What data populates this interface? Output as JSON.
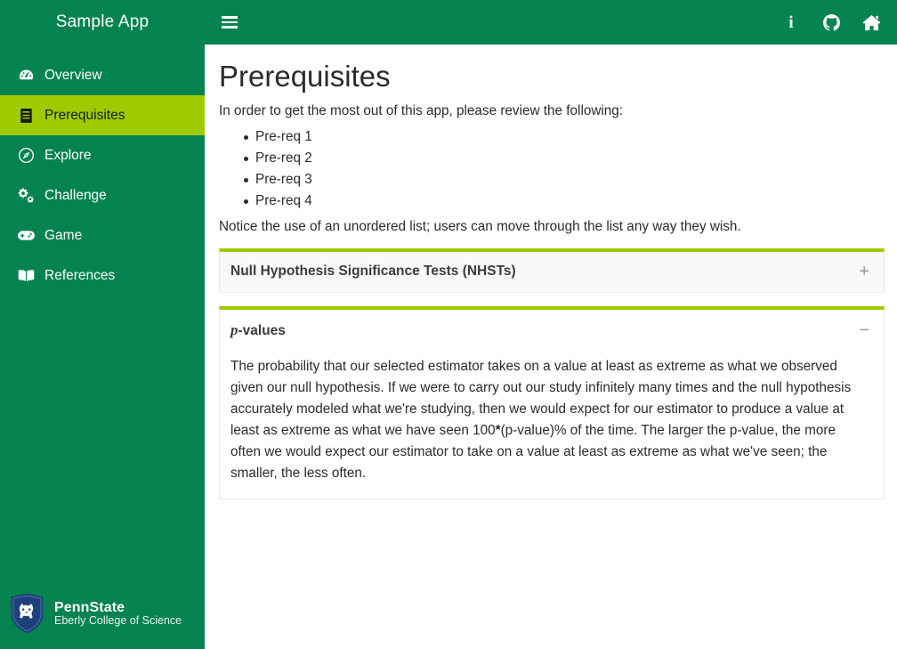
{
  "header": {
    "brand": "Sample App",
    "menu_icon": "hamburger-icon",
    "right_icons": [
      {
        "name": "info-icon",
        "glyph": "i"
      },
      {
        "name": "github-icon",
        "glyph": ""
      },
      {
        "name": "home-icon",
        "glyph": ""
      }
    ]
  },
  "sidebar": {
    "items": [
      {
        "label": "Overview",
        "icon": "dashboard-icon",
        "active": false
      },
      {
        "label": "Prerequisites",
        "icon": "book-list-icon",
        "active": true
      },
      {
        "label": "Explore",
        "icon": "compass-icon",
        "active": false
      },
      {
        "label": "Challenge",
        "icon": "cogs-icon",
        "active": false
      },
      {
        "label": "Game",
        "icon": "gamepad-icon",
        "active": false
      },
      {
        "label": "References",
        "icon": "book-open-icon",
        "active": false
      }
    ],
    "logo": {
      "name": "penn-state-logo",
      "title": "PennState",
      "subtitle": "Eberly College of Science",
      "shield_color": "#1E407C"
    }
  },
  "main": {
    "title": "Prerequisites",
    "intro": "In order to get the most out of this app, please review the following:",
    "prereqs": [
      "Pre-req 1",
      "Pre-req 2",
      "Pre-req 3",
      "Pre-req 4"
    ],
    "note": "Notice the use of an unordered list; users can move through the list any way they wish.",
    "accordion": [
      {
        "title": "Null Hypothesis Significance Tests (NHSTs)",
        "toggle": "+",
        "expanded": false,
        "body": ""
      },
      {
        "title_italic": "p",
        "title_rest": "-values",
        "toggle": "−",
        "expanded": true,
        "body_part1": "The probability that our selected estimator takes on a value at least as extreme as what we observed given our null hypothesis. If we were to carry out our study infinitely many times and the null hypothesis accurately modeled what we're studying, then we would expect for our estimator to produce a value at least as extreme as what we have seen 100",
        "body_bold": "*",
        "body_part2": "(p-value)% of the time. The larger the p-value, the more often we would expect our estimator to take on a value at least as extreme as what we've seen; the smaller, the less often."
      }
    ]
  },
  "colors": {
    "primary_green": "#048351",
    "accent_lime": "#9ecb00",
    "text_dark": "#2b2b2b",
    "panel_bg": "#f9f9f9",
    "toggle_gray": "#8d96a8"
  }
}
